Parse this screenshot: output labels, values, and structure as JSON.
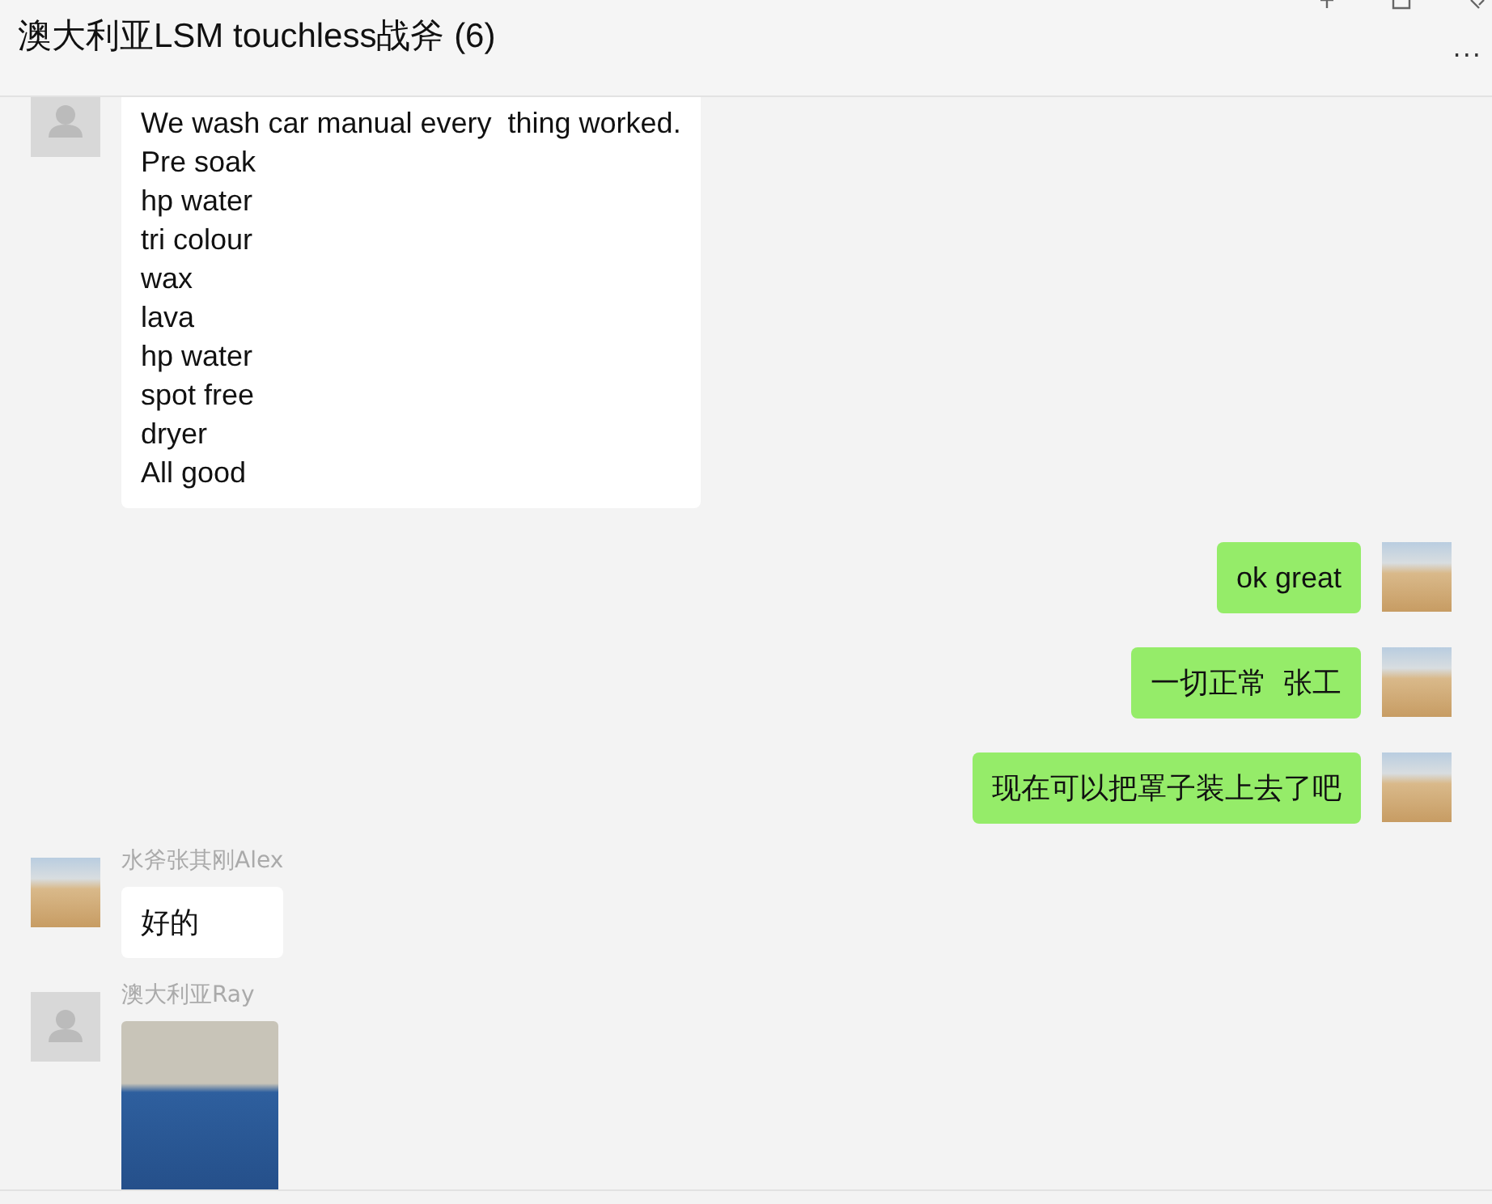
{
  "window": {
    "title": "澳大利亚LSM touchless战斧 (6)",
    "more": "..."
  },
  "messages": [
    {
      "outgoing": false,
      "default_avatar": true,
      "kind": "text",
      "text": "We wash car manual every  thing worked.\nPre soak\nhp water\ntri colour\nwax\nlava\nhp water\nspot free\ndryer\nAll good"
    },
    {
      "outgoing": true,
      "default_avatar": false,
      "kind": "text",
      "text": "ok great"
    },
    {
      "outgoing": true,
      "default_avatar": false,
      "kind": "text",
      "text": "一切正常  张工"
    },
    {
      "outgoing": true,
      "default_avatar": false,
      "kind": "text",
      "text": "现在可以把罩子装上去了吧"
    },
    {
      "outgoing": false,
      "default_avatar": false,
      "sender": "水斧张其刚Alex",
      "kind": "text",
      "text": "好的"
    },
    {
      "outgoing": false,
      "default_avatar": true,
      "sender": "澳大利亚Ray",
      "kind": "image"
    }
  ]
}
